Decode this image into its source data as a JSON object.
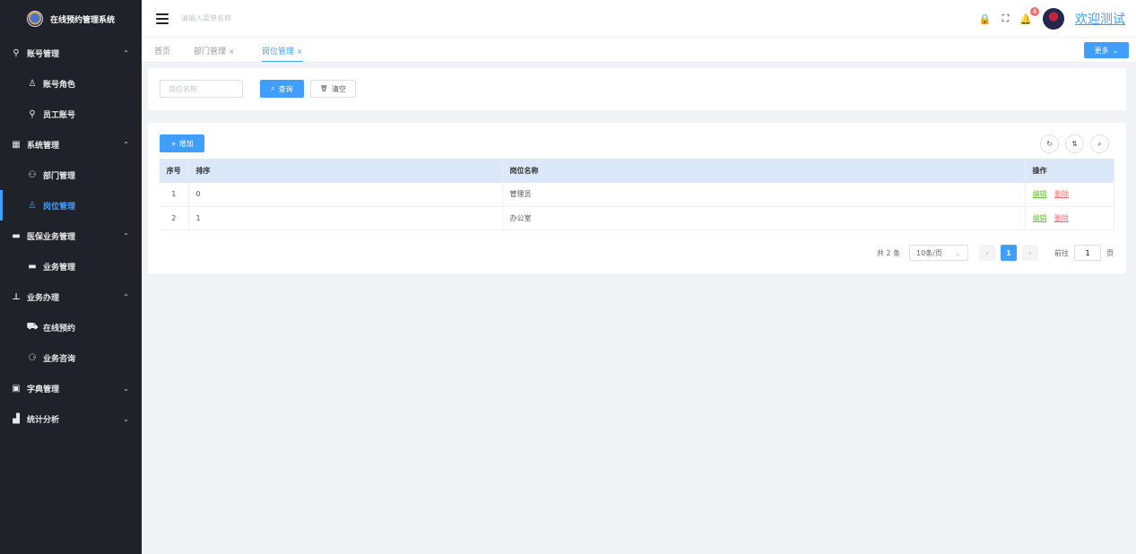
{
  "brand": {
    "title": "在线预约管理系统",
    "logo_icon": "brand-logo-icon"
  },
  "sidebar": {
    "items": [
      {
        "label": "账号管理",
        "icon": "user-icon",
        "glyph": "⚲",
        "type": "group",
        "arrow": "⌃"
      },
      {
        "label": "账号角色",
        "icon": "user-role-icon",
        "glyph": "♙",
        "type": "sub"
      },
      {
        "label": "员工账号",
        "icon": "user-icon",
        "glyph": "⚲",
        "type": "sub"
      },
      {
        "label": "系统管理",
        "icon": "grid-icon",
        "glyph": "▦",
        "type": "group",
        "arrow": "⌃"
      },
      {
        "label": "部门管理",
        "icon": "department-icon",
        "glyph": "⚇",
        "type": "sub"
      },
      {
        "label": "岗位管理",
        "icon": "post-icon",
        "glyph": "♙",
        "type": "sub",
        "active": true
      },
      {
        "label": "医保业务管理",
        "icon": "briefcase-icon",
        "glyph": "▬",
        "type": "group",
        "arrow": "⌃"
      },
      {
        "label": "业务管理",
        "icon": "briefcase-icon",
        "glyph": "▬",
        "type": "sub"
      },
      {
        "label": "业务办理",
        "icon": "stamp-icon",
        "glyph": "⊥",
        "type": "group",
        "arrow": "⌃"
      },
      {
        "label": "在线预约",
        "icon": "truck-icon",
        "glyph": "⛟",
        "type": "sub"
      },
      {
        "label": "业务咨询",
        "icon": "chat-icon",
        "glyph": "⚆",
        "type": "sub"
      },
      {
        "label": "字典管理",
        "icon": "dictionary-icon",
        "glyph": "▣",
        "type": "group",
        "arrow": "⌄"
      },
      {
        "label": "统计分析",
        "icon": "bar-chart-icon",
        "glyph": "▟",
        "type": "group",
        "arrow": "⌄"
      }
    ]
  },
  "header": {
    "search_placeholder": "请输入菜单名称",
    "notification_count": "4",
    "welcome": "欢迎测试",
    "lock_glyph": "🔒",
    "fullscreen_glyph": "⛶",
    "bell_glyph": "🔔"
  },
  "tabs": {
    "items": [
      {
        "label": "首页",
        "closable": false
      },
      {
        "label": "部门管理",
        "closable": true
      },
      {
        "label": "岗位管理",
        "closable": true,
        "active": true
      }
    ],
    "close_glyph": "×",
    "more_label": "更多",
    "more_arrow": "⌄"
  },
  "filter": {
    "post_name_placeholder": "岗位名称",
    "search_label": "查询",
    "search_glyph": "⌕",
    "clear_label": "清空",
    "clear_glyph": "🗑"
  },
  "table": {
    "add_label": "+ 增加",
    "refresh_glyph": "↻",
    "columns_glyph": "⇅",
    "search_glyph": "⌕",
    "columns": [
      "序号",
      "排序",
      "岗位名称",
      "操作"
    ],
    "rows": [
      {
        "index": "1",
        "sort": "0",
        "name": "管理员",
        "edit": "编辑",
        "delete": "删除"
      },
      {
        "index": "2",
        "sort": "1",
        "name": "办公室",
        "edit": "编辑",
        "delete": "删除"
      }
    ]
  },
  "pagination": {
    "total_text": "共 2 条",
    "page_size": "10条/页",
    "page_size_arrow": "⌄",
    "prev": "‹",
    "current_page": "1",
    "next": "›",
    "goto_label": "前往",
    "goto_value": "1",
    "page_unit": "页"
  },
  "colors": {
    "primary": "#409eff",
    "sidebar_bg": "#1f2329",
    "danger": "#f56c6c",
    "success": "#67c23a"
  }
}
